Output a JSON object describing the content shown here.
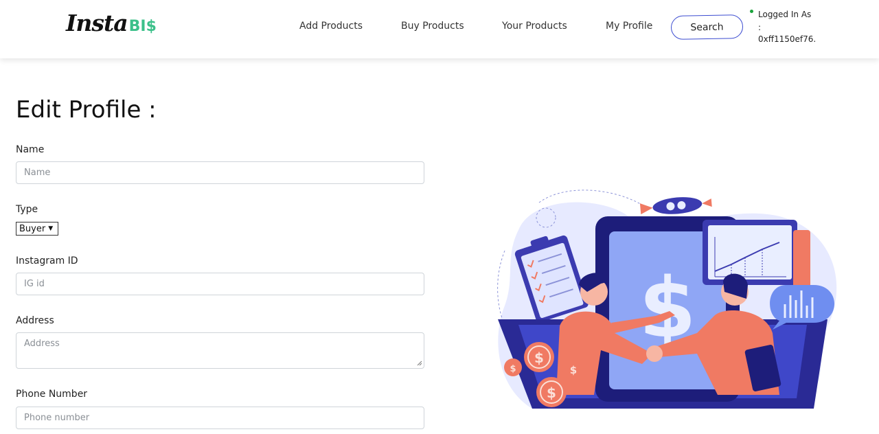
{
  "brand": {
    "name_main": "Insta",
    "name_accent": "BI$"
  },
  "nav": {
    "links": [
      "Add Products",
      "Buy Products",
      "Your Products",
      "My Profile"
    ],
    "search_label": "Search",
    "login_label": "Logged In As",
    "login_colon": ":",
    "login_address": "0xff1150ef76...",
    "status_color": "#1aa33b"
  },
  "form": {
    "title": "Edit Profile :",
    "name": {
      "label": "Name",
      "placeholder": "Name",
      "value": ""
    },
    "type": {
      "label": "Type",
      "selected": "Buyer"
    },
    "instagram": {
      "label": "Instagram ID",
      "placeholder": "IG id",
      "value": ""
    },
    "address": {
      "label": "Address",
      "placeholder": "Address",
      "value": ""
    },
    "phone": {
      "label": "Phone Number",
      "placeholder": "Phone number",
      "value": ""
    }
  },
  "colors": {
    "accent": "#3b4bd0",
    "brand_green": "#3cc08a",
    "illustration_blue": "#3b3bb0",
    "illustration_coral": "#f07a63"
  }
}
